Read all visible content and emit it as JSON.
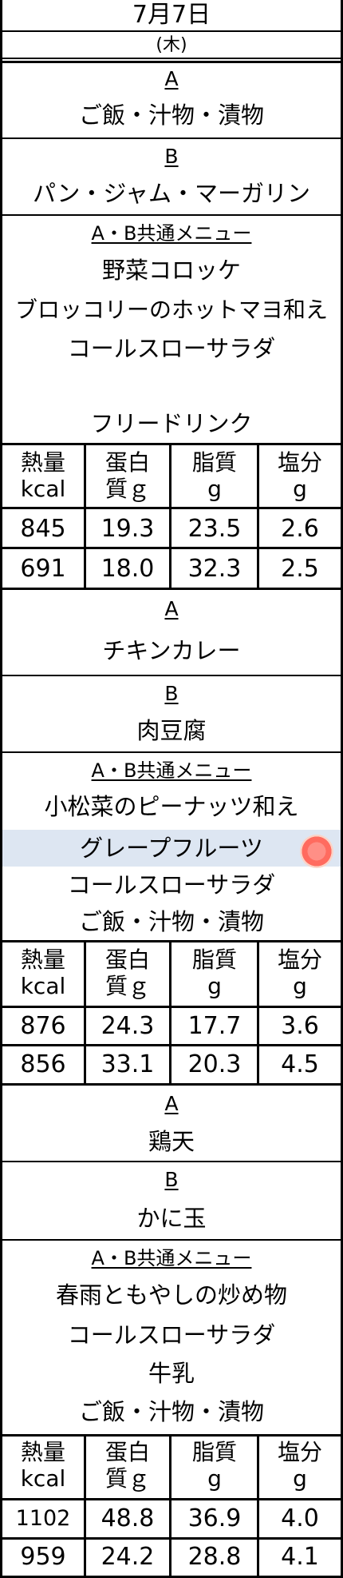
{
  "header": {
    "date": "7月7日",
    "day": "(木)"
  },
  "nutrition_headers": [
    {
      "l1": "熱量",
      "l2": "kcal"
    },
    {
      "l1": "蛋白",
      "l2": "質ｇ"
    },
    {
      "l1": "脂質",
      "l2": "g"
    },
    {
      "l1": "塩分",
      "l2": "g"
    }
  ],
  "sections": [
    {
      "a_label": "A",
      "a_menu": "ご飯・汁物・漬物",
      "b_label": "B",
      "b_menu": "パン・ジャム・マーガリン",
      "common_label": "A・B共通メニュー",
      "common_items": [
        "野菜コロッケ",
        "ブロッコリーのホットマヨ和え",
        "コールスローサラダ",
        "",
        "フリードリンク"
      ],
      "nutrition": {
        "a": [
          "845",
          "19.3",
          "23.5",
          "2.6"
        ],
        "b": [
          "691",
          "18.0",
          "32.3",
          "2.5"
        ]
      }
    },
    {
      "a_label": "A",
      "a_menu": "チキンカレー",
      "b_label": "B",
      "b_menu": "肉豆腐",
      "common_label": "A・B共通メニュー",
      "common_items": [
        "小松菜のピーナッツ和え",
        "グレープフルーツ",
        "コールスローサラダ",
        "ご飯・汁物・漬物"
      ],
      "nutrition": {
        "a": [
          "876",
          "24.3",
          "17.7",
          "3.6"
        ],
        "b": [
          "856",
          "33.1",
          "20.3",
          "4.5"
        ]
      }
    },
    {
      "a_label": "A",
      "a_menu": "鶏天",
      "b_label": "B",
      "b_menu": "かに玉",
      "common_label": "A・B共通メニュー",
      "common_items": [
        "春雨ともやしの炒め物",
        "コールスローサラダ",
        "牛乳",
        "ご飯・汁物・漬物"
      ],
      "nutrition": {
        "a": [
          "1102",
          "48.8",
          "36.9",
          "4.0"
        ],
        "b": [
          "959",
          "24.2",
          "28.8",
          "4.1"
        ]
      }
    }
  ],
  "icons": {
    "highlight_item_icon": "grapefruit-icon"
  },
  "colors": {
    "highlight_row": "#dde6f2",
    "border": "#000000"
  }
}
